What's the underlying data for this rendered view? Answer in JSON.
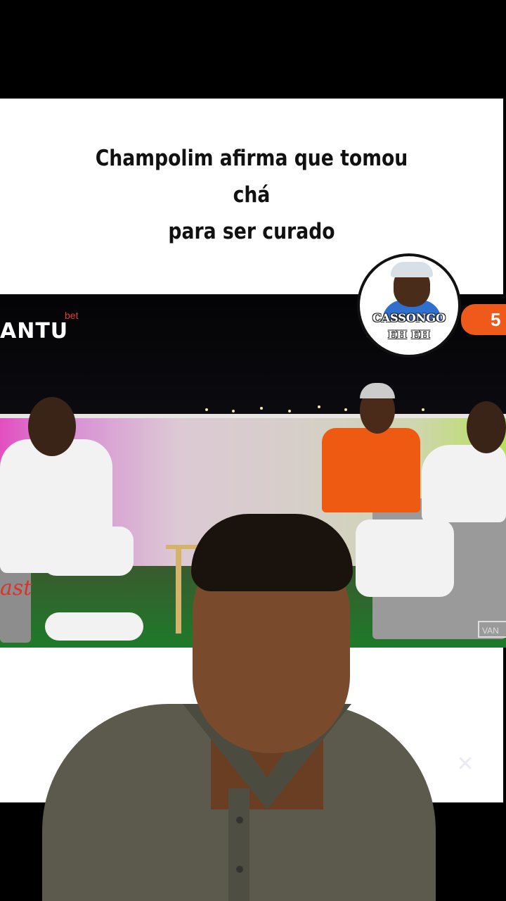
{
  "caption": {
    "line1": "Champolim afirma que tomou chá",
    "line2": "para ser curado"
  },
  "video": {
    "logo": "ANTU",
    "logo_sub": "bet",
    "badge_number": "5",
    "corner_tag": "VAN",
    "podcast_mark": "ast"
  },
  "channel": {
    "name_line1": "CASSONGO",
    "name_line2": "EH EH"
  },
  "icons": {
    "watermark": "capcut-logo-icon"
  },
  "colors": {
    "badge": "#ef5a1a",
    "caption_bg": "#ffffff",
    "page_bg": "#000000"
  }
}
